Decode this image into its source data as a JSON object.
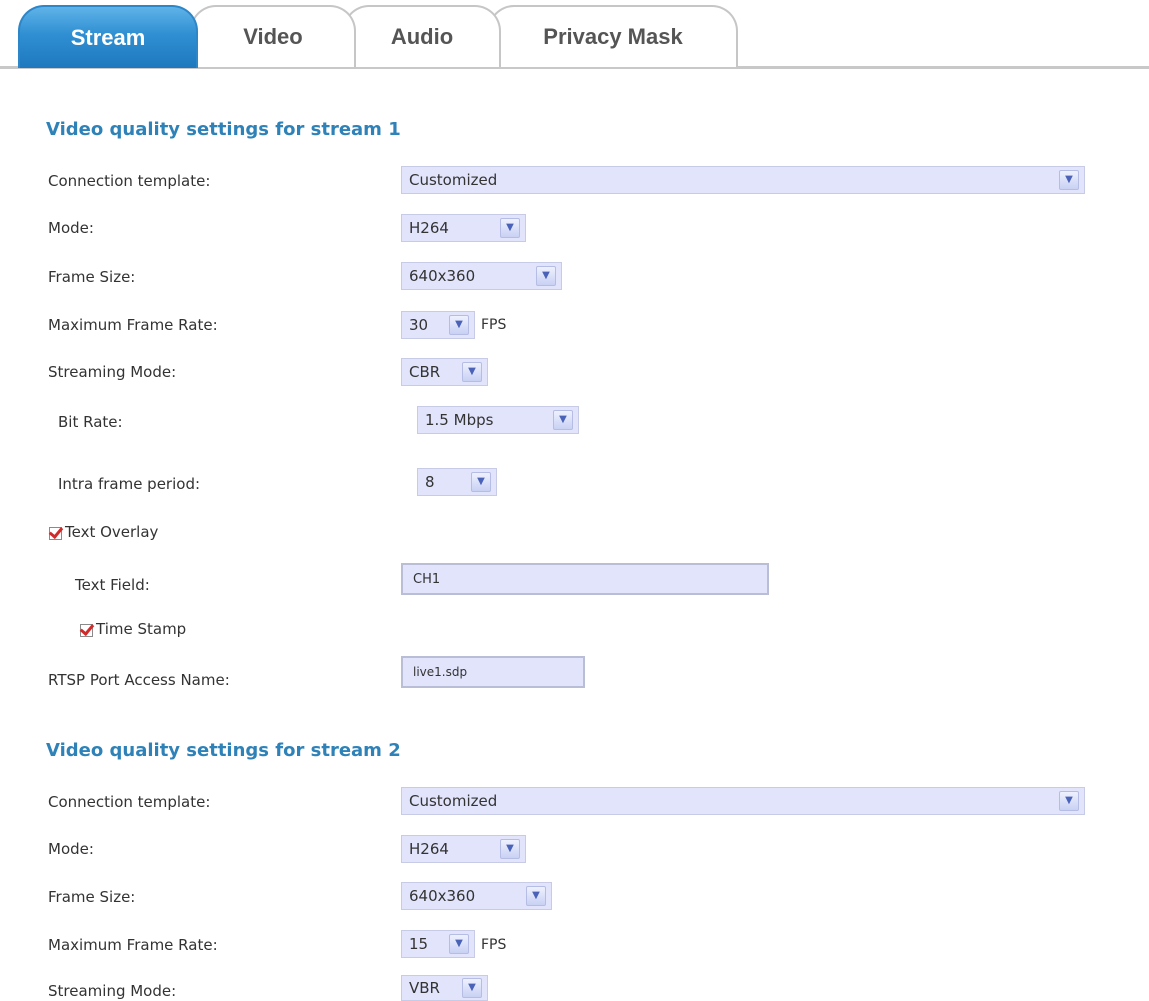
{
  "tabs": [
    "Stream",
    "Video",
    "Audio",
    "Privacy Mask"
  ],
  "stream1": {
    "title": "Video quality settings for stream  1",
    "connection_template": {
      "label": "Connection template:",
      "value": "Customized"
    },
    "mode": {
      "label": "Mode:",
      "value": "H264"
    },
    "frame_size": {
      "label": "Frame Size:",
      "value": "640x360"
    },
    "max_frame_rate": {
      "label": "Maximum Frame Rate:",
      "value": "30",
      "unit": "FPS"
    },
    "streaming_mode": {
      "label": "Streaming Mode:",
      "value": "CBR"
    },
    "bit_rate": {
      "label": "Bit Rate:",
      "value": "1.5 Mbps"
    },
    "intra_frame": {
      "label": "Intra frame period:",
      "value": "8"
    },
    "text_overlay": {
      "label": "Text Overlay",
      "checked": true
    },
    "text_field": {
      "label": "Text Field:",
      "value": "CH1"
    },
    "time_stamp": {
      "label": "Time Stamp",
      "checked": true
    },
    "rtsp": {
      "label": "RTSP Port Access Name:",
      "value": "live1.sdp"
    }
  },
  "stream2": {
    "title": "Video quality settings for stream  2",
    "connection_template": {
      "label": "Connection template:",
      "value": "Customized"
    },
    "mode": {
      "label": "Mode:",
      "value": "H264"
    },
    "frame_size": {
      "label": "Frame Size:",
      "value": "640x360"
    },
    "max_frame_rate": {
      "label": "Maximum Frame Rate:",
      "value": "15",
      "unit": "FPS"
    },
    "streaming_mode": {
      "label": "Streaming Mode:",
      "value": "VBR"
    }
  },
  "icons": {
    "dropdown": "chevron-down-icon",
    "checkbox": "checkmark-icon"
  },
  "colors": {
    "tab_active": "#2f8fd2",
    "section_title": "#2e82b8",
    "field_bg": "#e1e4fb",
    "checkmark": "#d22a2a"
  }
}
